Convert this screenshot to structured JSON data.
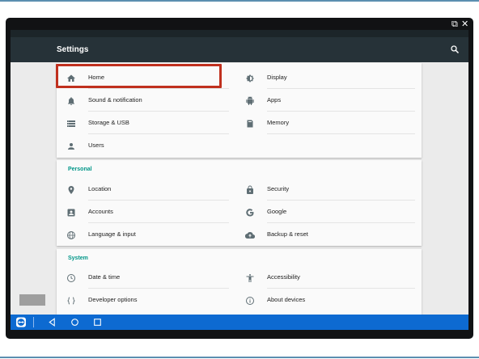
{
  "app": {
    "title": "Settings"
  },
  "window_controls": [
    {
      "name": "popout-icon",
      "glyph": "⧉"
    },
    {
      "name": "close-icon",
      "glyph": "✕"
    }
  ],
  "sections": {
    "device": {
      "items": [
        {
          "label": "Home",
          "icon": "home-icon"
        },
        {
          "label": "Display",
          "icon": "brightness-icon"
        },
        {
          "label": "Sound & notification",
          "icon": "bell-icon"
        },
        {
          "label": "Apps",
          "icon": "android-icon"
        },
        {
          "label": "Storage & USB",
          "icon": "storage-icon"
        },
        {
          "label": "Memory",
          "icon": "memory-icon"
        },
        {
          "label": "Users",
          "icon": "person-icon"
        }
      ]
    },
    "personal": {
      "header": "Personal",
      "items": [
        {
          "label": "Location",
          "icon": "location-pin-icon"
        },
        {
          "label": "Security",
          "icon": "lock-icon"
        },
        {
          "label": "Accounts",
          "icon": "account-box-icon"
        },
        {
          "label": "Google",
          "icon": "google-icon"
        },
        {
          "label": "Language & input",
          "icon": "globe-icon"
        },
        {
          "label": "Backup & reset",
          "icon": "cloud-upload-icon"
        }
      ]
    },
    "system": {
      "header": "System",
      "items": [
        {
          "label": "Date & time",
          "icon": "clock-icon"
        },
        {
          "label": "Accessibility",
          "icon": "accessibility-icon"
        },
        {
          "label": "Developer options",
          "icon": "code-braces-icon"
        },
        {
          "label": "About devices",
          "icon": "info-icon"
        }
      ]
    }
  },
  "highlighted_item": "Home",
  "navbar": {
    "buttons": [
      "back-icon",
      "home-circle-icon",
      "recents-icon"
    ]
  },
  "colors": {
    "appbar": "#263238",
    "accent": "#009688",
    "icon": "#5f6e74",
    "highlight": "#c0301e",
    "navbar": "#0d6ad1"
  }
}
